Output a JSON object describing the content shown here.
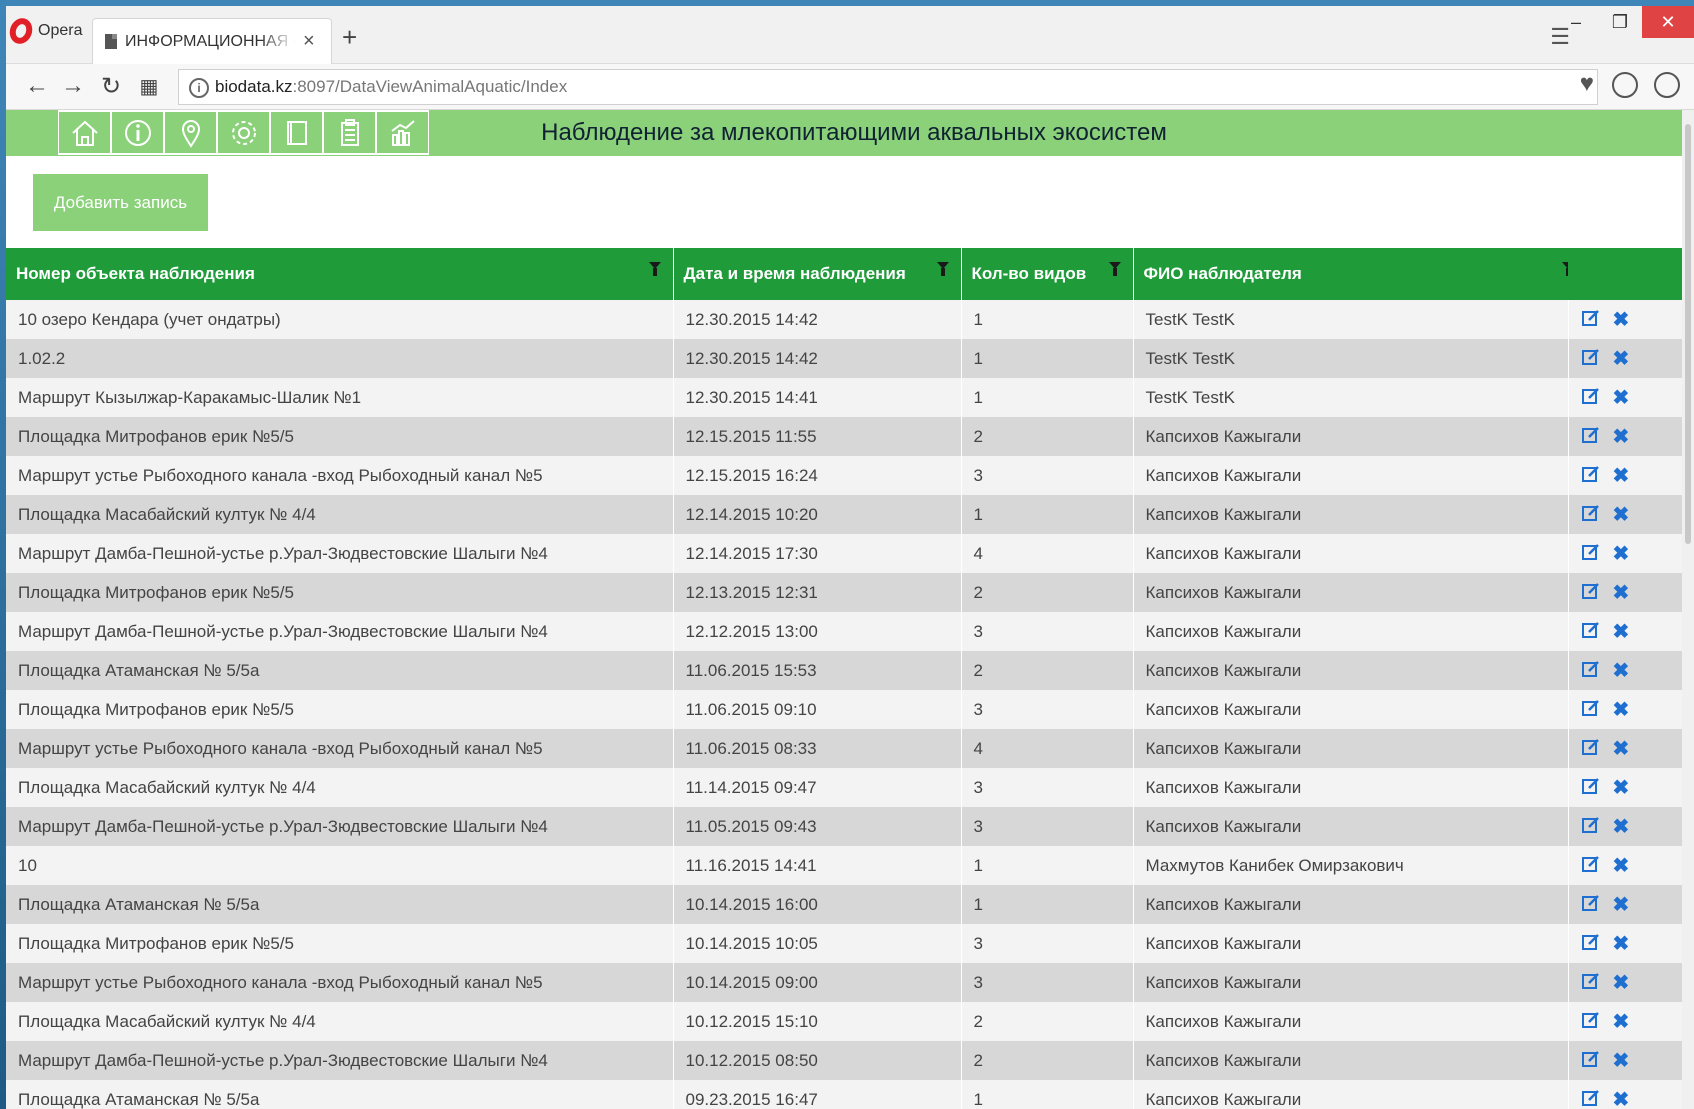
{
  "browser": {
    "name": "Opera",
    "tab_title": "ИНФОРМАЦИОННАЯ СИ",
    "url_host": "biodata.kz",
    "url_path": ":8097/DataViewAnimalAquatic/Index"
  },
  "header": {
    "title": "Наблюдение за млекопитающими аквальных экосистем",
    "nav_icons": [
      "home-icon",
      "info-icon",
      "map-pin-icon",
      "gear-icon",
      "book-icon",
      "clipboard-icon",
      "chart-icon"
    ]
  },
  "toolbar": {
    "add_label": "Добавить запись"
  },
  "table": {
    "columns": [
      "Номер объекта наблюдения",
      "Дата и время наблюдения",
      "Кол-во видов",
      "ФИО наблюдателя"
    ],
    "rows": [
      [
        "10 озеро Кендара (учет ондатры)",
        "12.30.2015 14:42",
        "1",
        "TestK TestK"
      ],
      [
        "1.02.2",
        "12.30.2015 14:42",
        "1",
        "TestK TestK"
      ],
      [
        "Маршрут Кызылжар-Каракамыс-Шалик №1",
        "12.30.2015 14:41",
        "1",
        "TestK TestK"
      ],
      [
        "Площадка Митрофанов ерик №5/5",
        "12.15.2015 11:55",
        "2",
        "Капсихов Кажыгали"
      ],
      [
        "Маршрут устье Рыбоходного канала -вход Рыбоходный канал №5",
        "12.15.2015 16:24",
        "3",
        "Капсихов Кажыгали"
      ],
      [
        "Площадка Масабайский култук № 4/4",
        "12.14.2015 10:20",
        "1",
        "Капсихов Кажыгали"
      ],
      [
        "Маршрут Дамба-Пешной-устье р.Урал-Зюдвестовские Шалыги №4",
        "12.14.2015 17:30",
        "4",
        "Капсихов Кажыгали"
      ],
      [
        "Площадка Митрофанов ерик №5/5",
        "12.13.2015 12:31",
        "2",
        "Капсихов Кажыгали"
      ],
      [
        "Маршрут Дамба-Пешной-устье р.Урал-Зюдвестовские Шалыги №4",
        "12.12.2015 13:00",
        "3",
        "Капсихов Кажыгали"
      ],
      [
        "Площадка Атаманская № 5/5а",
        "11.06.2015 15:53",
        "2",
        "Капсихов Кажыгали"
      ],
      [
        "Площадка Митрофанов ерик №5/5",
        "11.06.2015 09:10",
        "3",
        "Капсихов Кажыгали"
      ],
      [
        "Маршрут устье Рыбоходного канала -вход Рыбоходный канал №5",
        "11.06.2015 08:33",
        "4",
        "Капсихов Кажыгали"
      ],
      [
        "Площадка Масабайский култук № 4/4",
        "11.14.2015 09:47",
        "3",
        "Капсихов Кажыгали"
      ],
      [
        "Маршрут Дамба-Пешной-устье р.Урал-Зюдвестовские Шалыги №4",
        "11.05.2015 09:43",
        "3",
        "Капсихов Кажыгали"
      ],
      [
        "10",
        "11.16.2015 14:41",
        "1",
        "Махмутов Канибек Омирзакович"
      ],
      [
        "Площадка Атаманская № 5/5а",
        "10.14.2015 16:00",
        "1",
        "Капсихов Кажыгали"
      ],
      [
        "Площадка Митрофанов ерик №5/5",
        "10.14.2015 10:05",
        "3",
        "Капсихов Кажыгали"
      ],
      [
        "Маршрут устье Рыбоходного канала -вход Рыбоходный канал №5",
        "10.14.2015 09:00",
        "3",
        "Капсихов Кажыгали"
      ],
      [
        "Площадка Масабайский култук № 4/4",
        "10.12.2015 15:10",
        "2",
        "Капсихов Кажыгали"
      ],
      [
        "Маршрут Дамба-Пешной-устье р.Урал-Зюдвестовские Шалыги №4",
        "10.12.2015 08:50",
        "2",
        "Капсихов Кажыгали"
      ],
      [
        "Площадка Атаманская № 5/5а",
        "09.23.2015 16:47",
        "1",
        "Капсихов Кажыгали"
      ]
    ]
  },
  "colors": {
    "header_bg": "#8ad17a",
    "table_header_bg": "#1f9b3a",
    "row_light": "#f3f3f3",
    "row_dark": "#d7d7d7",
    "action_blue": "#1e6fd0"
  }
}
